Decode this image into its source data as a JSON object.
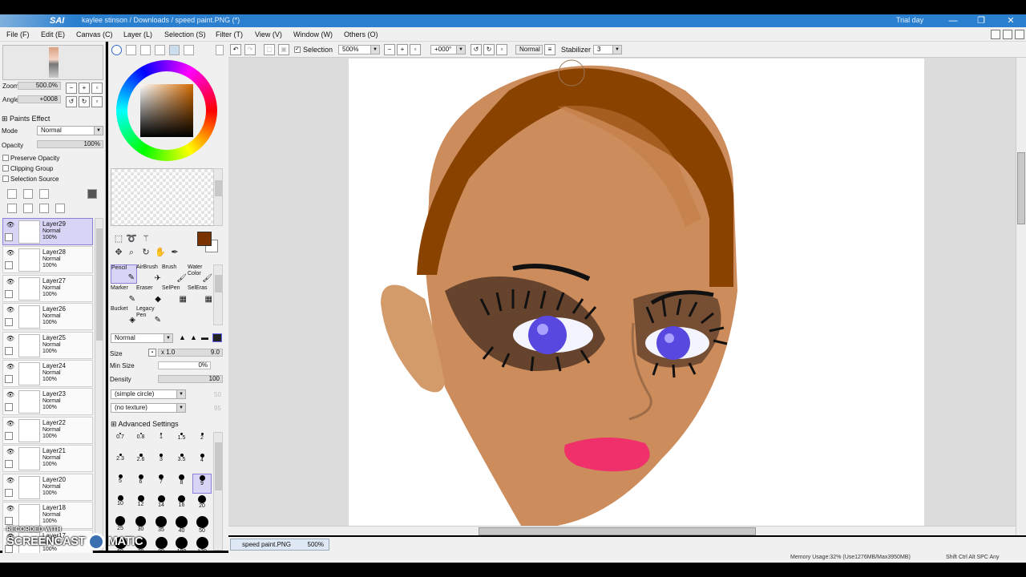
{
  "app": {
    "logo": "SAI",
    "title": "kaylee stinson / Downloads / speed paint.PNG (*)",
    "trial": "Trial day",
    "window_controls": [
      "—",
      "❐",
      "✕"
    ]
  },
  "menubar": {
    "items": [
      "File (F)",
      "Edit (E)",
      "Canvas (C)",
      "Layer (L)",
      "Selection (S)",
      "Filter (T)",
      "View (V)",
      "Window (W)",
      "Others (O)"
    ]
  },
  "navigator": {
    "zoom_label": "Zoom",
    "zoom_value": "500.0%",
    "angle_label": "Angle",
    "angle_value": "+0008"
  },
  "layer_panel": {
    "paints_effect": "Paints Effect",
    "mode_label": "Mode",
    "mode_value": "Normal",
    "opacity_label": "Opacity",
    "opacity_value": "100%",
    "preserve_opacity": "Preserve Opacity",
    "clipping_group": "Clipping Group",
    "selection_source": "Selection Source",
    "layers": [
      {
        "name": "Layer29",
        "mode": "Normal",
        "opacity": "100%",
        "selected": true
      },
      {
        "name": "Layer28",
        "mode": "Normal",
        "opacity": "100%",
        "selected": false
      },
      {
        "name": "Layer27",
        "mode": "Normal",
        "opacity": "100%",
        "selected": false
      },
      {
        "name": "Layer26",
        "mode": "Normal",
        "opacity": "100%",
        "selected": false
      },
      {
        "name": "Layer25",
        "mode": "Normal",
        "opacity": "100%",
        "selected": false
      },
      {
        "name": "Layer24",
        "mode": "Normal",
        "opacity": "100%",
        "selected": false
      },
      {
        "name": "Layer23",
        "mode": "Normal",
        "opacity": "100%",
        "selected": false
      },
      {
        "name": "Layer22",
        "mode": "Normal",
        "opacity": "100%",
        "selected": false
      },
      {
        "name": "Layer21",
        "mode": "Normal",
        "opacity": "100%",
        "selected": false
      },
      {
        "name": "Layer20",
        "mode": "Normal",
        "opacity": "100%",
        "selected": false
      },
      {
        "name": "Layer18",
        "mode": "Normal",
        "opacity": "100%",
        "selected": false
      },
      {
        "name": "Layer17",
        "mode": "Normal",
        "opacity": "100%",
        "selected": false
      }
    ]
  },
  "tools": {
    "current_color": "#7a3200",
    "brushes": [
      {
        "label": "Pencil",
        "glyph": "✎",
        "selected": true
      },
      {
        "label": "AirBrush",
        "glyph": "✈",
        "selected": false
      },
      {
        "label": "Brush",
        "glyph": "🖌",
        "selected": false
      },
      {
        "label": "Water Color",
        "glyph": "🖌",
        "selected": false
      },
      {
        "label": "Marker",
        "glyph": "✎",
        "selected": false
      },
      {
        "label": "Eraser",
        "glyph": "◆",
        "selected": false
      },
      {
        "label": "SelPen",
        "glyph": "▦",
        "selected": false
      },
      {
        "label": "SelEras",
        "glyph": "▦",
        "selected": false
      },
      {
        "label": "Bucket",
        "glyph": "◈",
        "selected": false
      },
      {
        "label": "Legacy Pen",
        "glyph": "✎",
        "selected": false
      }
    ],
    "blend_mode": "Normal",
    "size_label": "Size",
    "size_multiplier": "x 1.0",
    "size_value": "9.0",
    "min_size_label": "Min Size",
    "min_size_value": "0%",
    "density_label": "Density",
    "density_value": "100",
    "shape": "(simple circle)",
    "shape_value": "50",
    "texture": "(no texture)",
    "texture_value": "95",
    "advanced_settings": "Advanced Settings",
    "brush_sizes": [
      "0.7",
      "0.8",
      "1",
      "1.5",
      "2",
      "2.3",
      "2.6",
      "3",
      "3.5",
      "4",
      "5",
      "6",
      "7",
      "8",
      "9",
      "10",
      "12",
      "14",
      "16",
      "20",
      "25",
      "30",
      "35",
      "40",
      "50",
      "60",
      "70",
      "80",
      "100",
      "120"
    ],
    "selected_brush_size": "9"
  },
  "toolbar": {
    "selection_label": "Selection",
    "zoom": "500%",
    "angle": "+000°",
    "blend": "Normal",
    "stabilizer_label": "Stabilizer",
    "stabilizer_value": "3"
  },
  "document": {
    "tab_name": "speed paint.PNG",
    "tab_zoom": "500%"
  },
  "status": {
    "memory": "Memory Usage:32% (Use1276MB/Max3950MB)",
    "keys": "Shift Ctrl Alt SPC Any"
  },
  "watermark": {
    "recorded": "RECORDED WITH",
    "brand": "SCREENCAST",
    "brand_suffix": "MATIC"
  },
  "colors": {
    "accent": "#2a7fcf",
    "selection_highlight": "#d8d4f6",
    "hair": "#8a4200",
    "skin": "#c98a5a",
    "lips": "#f0306a",
    "iris": "#5848e0"
  }
}
